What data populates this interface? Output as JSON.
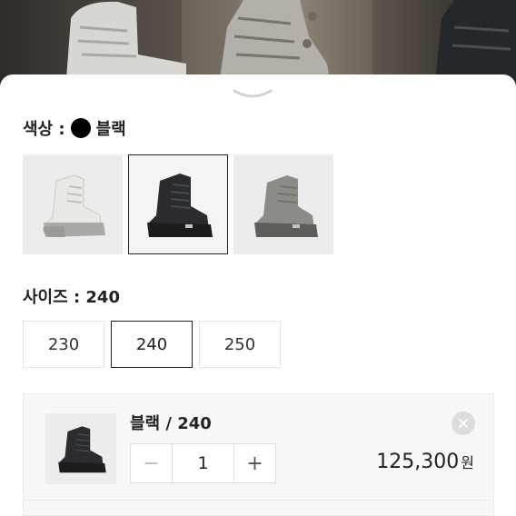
{
  "color_option": {
    "label": "색상 :",
    "selected_name": "블랙",
    "swatches": [
      {
        "name": "white",
        "selected": false
      },
      {
        "name": "black",
        "selected": true
      },
      {
        "name": "gray",
        "selected": false
      }
    ]
  },
  "size_option": {
    "label": "사이즈 : 240",
    "sizes": [
      "230",
      "240",
      "250"
    ],
    "selected": "240"
  },
  "selected_item": {
    "name": "블랙 / 240",
    "quantity": "1",
    "minus_label": "−",
    "plus_label": "+",
    "price": "125,300",
    "currency": "원"
  },
  "colors": {
    "accent": "#222222",
    "swatch_bg": "#ececec",
    "panel_bg": "#f7f7f7"
  }
}
